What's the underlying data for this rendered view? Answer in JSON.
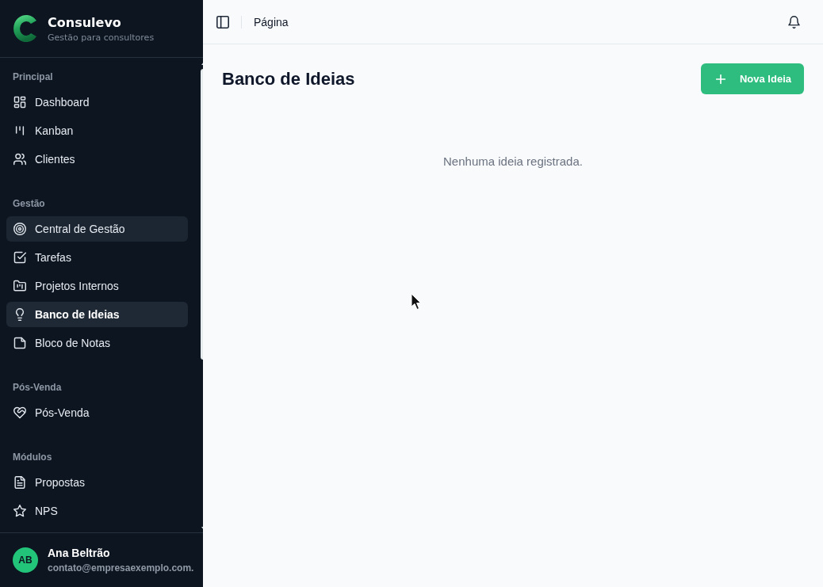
{
  "sidebar": {
    "brand": {
      "name": "Consulevo",
      "tagline": "Gestão para consultores"
    },
    "sections": [
      {
        "title": "Principal",
        "items": [
          {
            "label": "Dashboard",
            "selected": false,
            "hovered": false
          },
          {
            "label": "Kanban",
            "selected": false,
            "hovered": false
          },
          {
            "label": "Clientes",
            "selected": false,
            "hovered": false
          }
        ]
      },
      {
        "title": "Gestão",
        "items": [
          {
            "label": "Central de Gestão",
            "selected": false,
            "hovered": true
          },
          {
            "label": "Tarefas",
            "selected": false,
            "hovered": false
          },
          {
            "label": "Projetos Internos",
            "selected": false,
            "hovered": false
          },
          {
            "label": "Banco de Ideias",
            "selected": true,
            "hovered": false
          },
          {
            "label": "Bloco de Notas",
            "selected": false,
            "hovered": false
          }
        ]
      },
      {
        "title": "Pós-Venda",
        "items": [
          {
            "label": "Pós-Venda",
            "selected": false,
            "hovered": false
          }
        ]
      },
      {
        "title": "Módulos",
        "items": [
          {
            "label": "Propostas",
            "selected": false,
            "hovered": false
          },
          {
            "label": "NPS",
            "selected": false,
            "hovered": false
          }
        ]
      }
    ],
    "user": {
      "initials": "AB",
      "name": "Ana Beltrão",
      "email": "contato@empresaexemplo.com."
    }
  },
  "topbar": {
    "breadcrumb": "Página"
  },
  "page": {
    "title": "Banco de Ideias",
    "new_button": "Nova Ideia",
    "empty_message": "Nenhuma ideia registrada."
  },
  "mouse_pointer": {
    "kind": "arrow"
  }
}
